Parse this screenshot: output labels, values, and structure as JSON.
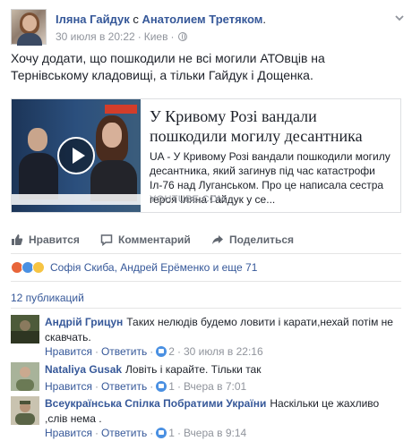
{
  "post": {
    "author": "Іляна Гайдук",
    "with_word": "с",
    "tagged": "Анатолием Третяком",
    "period": ".",
    "date": "30 июля в 20:22",
    "location": "Киев",
    "text": "Хочу додати, що пошкодили не всі могили АТОвців на Тернівському кладовищі, а тільки Гайдук і Дощенка."
  },
  "link_card": {
    "title": "У Кривому Розі вандали пошкодили могилу десантника",
    "description": "UA - У Кривому Розі вандали пошкодили могилу десантника, який загинув під час катастрофи Іл-76 над Луганськом. Про це написала сестра героя Іляна Гайдук у се...",
    "domain": "YOUTUBE.COM"
  },
  "actions": {
    "like": "Нравится",
    "comment": "Комментарий",
    "share": "Поделиться"
  },
  "reactions": {
    "names": "Софія Скиба, Андрей Ерёменко и еще 71"
  },
  "publications": "12 публикаций",
  "comments": [
    {
      "name": "Андрій Грицун",
      "text": "Таких нелюдів будемо ловити і карати,нехай потім не скавчать.",
      "like": "Нравится",
      "reply": "Ответить",
      "likes": "2",
      "time": "30 июля в 22:16"
    },
    {
      "name": "Nataliya Gusak",
      "text": "Ловіть і карайте. Тільки так",
      "like": "Нравится",
      "reply": "Ответить",
      "likes": "1",
      "time": "Вчера в 7:01"
    },
    {
      "name": "Всеукраїнська Спілка Побратими України",
      "text": "Наскільки це жахливо ,слів нема .",
      "like": "Нравится",
      "reply": "Ответить",
      "likes": "1",
      "time": "Вчера в 9:14"
    }
  ],
  "colors": {
    "link": "#365899",
    "muted": "#90949c",
    "text": "#1d2129",
    "action": "#616770"
  }
}
